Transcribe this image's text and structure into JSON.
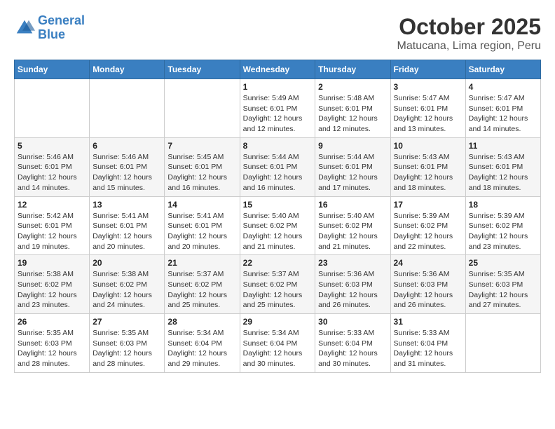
{
  "header": {
    "logo_line1": "General",
    "logo_line2": "Blue",
    "title": "October 2025",
    "subtitle": "Matucana, Lima region, Peru"
  },
  "days_of_week": [
    "Sunday",
    "Monday",
    "Tuesday",
    "Wednesday",
    "Thursday",
    "Friday",
    "Saturday"
  ],
  "weeks": [
    [
      {
        "day": "",
        "info": ""
      },
      {
        "day": "",
        "info": ""
      },
      {
        "day": "",
        "info": ""
      },
      {
        "day": "1",
        "info": "Sunrise: 5:49 AM\nSunset: 6:01 PM\nDaylight: 12 hours\nand 12 minutes."
      },
      {
        "day": "2",
        "info": "Sunrise: 5:48 AM\nSunset: 6:01 PM\nDaylight: 12 hours\nand 12 minutes."
      },
      {
        "day": "3",
        "info": "Sunrise: 5:47 AM\nSunset: 6:01 PM\nDaylight: 12 hours\nand 13 minutes."
      },
      {
        "day": "4",
        "info": "Sunrise: 5:47 AM\nSunset: 6:01 PM\nDaylight: 12 hours\nand 14 minutes."
      }
    ],
    [
      {
        "day": "5",
        "info": "Sunrise: 5:46 AM\nSunset: 6:01 PM\nDaylight: 12 hours\nand 14 minutes."
      },
      {
        "day": "6",
        "info": "Sunrise: 5:46 AM\nSunset: 6:01 PM\nDaylight: 12 hours\nand 15 minutes."
      },
      {
        "day": "7",
        "info": "Sunrise: 5:45 AM\nSunset: 6:01 PM\nDaylight: 12 hours\nand 16 minutes."
      },
      {
        "day": "8",
        "info": "Sunrise: 5:44 AM\nSunset: 6:01 PM\nDaylight: 12 hours\nand 16 minutes."
      },
      {
        "day": "9",
        "info": "Sunrise: 5:44 AM\nSunset: 6:01 PM\nDaylight: 12 hours\nand 17 minutes."
      },
      {
        "day": "10",
        "info": "Sunrise: 5:43 AM\nSunset: 6:01 PM\nDaylight: 12 hours\nand 18 minutes."
      },
      {
        "day": "11",
        "info": "Sunrise: 5:43 AM\nSunset: 6:01 PM\nDaylight: 12 hours\nand 18 minutes."
      }
    ],
    [
      {
        "day": "12",
        "info": "Sunrise: 5:42 AM\nSunset: 6:01 PM\nDaylight: 12 hours\nand 19 minutes."
      },
      {
        "day": "13",
        "info": "Sunrise: 5:41 AM\nSunset: 6:01 PM\nDaylight: 12 hours\nand 20 minutes."
      },
      {
        "day": "14",
        "info": "Sunrise: 5:41 AM\nSunset: 6:01 PM\nDaylight: 12 hours\nand 20 minutes."
      },
      {
        "day": "15",
        "info": "Sunrise: 5:40 AM\nSunset: 6:02 PM\nDaylight: 12 hours\nand 21 minutes."
      },
      {
        "day": "16",
        "info": "Sunrise: 5:40 AM\nSunset: 6:02 PM\nDaylight: 12 hours\nand 21 minutes."
      },
      {
        "day": "17",
        "info": "Sunrise: 5:39 AM\nSunset: 6:02 PM\nDaylight: 12 hours\nand 22 minutes."
      },
      {
        "day": "18",
        "info": "Sunrise: 5:39 AM\nSunset: 6:02 PM\nDaylight: 12 hours\nand 23 minutes."
      }
    ],
    [
      {
        "day": "19",
        "info": "Sunrise: 5:38 AM\nSunset: 6:02 PM\nDaylight: 12 hours\nand 23 minutes."
      },
      {
        "day": "20",
        "info": "Sunrise: 5:38 AM\nSunset: 6:02 PM\nDaylight: 12 hours\nand 24 minutes."
      },
      {
        "day": "21",
        "info": "Sunrise: 5:37 AM\nSunset: 6:02 PM\nDaylight: 12 hours\nand 25 minutes."
      },
      {
        "day": "22",
        "info": "Sunrise: 5:37 AM\nSunset: 6:02 PM\nDaylight: 12 hours\nand 25 minutes."
      },
      {
        "day": "23",
        "info": "Sunrise: 5:36 AM\nSunset: 6:03 PM\nDaylight: 12 hours\nand 26 minutes."
      },
      {
        "day": "24",
        "info": "Sunrise: 5:36 AM\nSunset: 6:03 PM\nDaylight: 12 hours\nand 26 minutes."
      },
      {
        "day": "25",
        "info": "Sunrise: 5:35 AM\nSunset: 6:03 PM\nDaylight: 12 hours\nand 27 minutes."
      }
    ],
    [
      {
        "day": "26",
        "info": "Sunrise: 5:35 AM\nSunset: 6:03 PM\nDaylight: 12 hours\nand 28 minutes."
      },
      {
        "day": "27",
        "info": "Sunrise: 5:35 AM\nSunset: 6:03 PM\nDaylight: 12 hours\nand 28 minutes."
      },
      {
        "day": "28",
        "info": "Sunrise: 5:34 AM\nSunset: 6:04 PM\nDaylight: 12 hours\nand 29 minutes."
      },
      {
        "day": "29",
        "info": "Sunrise: 5:34 AM\nSunset: 6:04 PM\nDaylight: 12 hours\nand 30 minutes."
      },
      {
        "day": "30",
        "info": "Sunrise: 5:33 AM\nSunset: 6:04 PM\nDaylight: 12 hours\nand 30 minutes."
      },
      {
        "day": "31",
        "info": "Sunrise: 5:33 AM\nSunset: 6:04 PM\nDaylight: 12 hours\nand 31 minutes."
      },
      {
        "day": "",
        "info": ""
      }
    ]
  ]
}
